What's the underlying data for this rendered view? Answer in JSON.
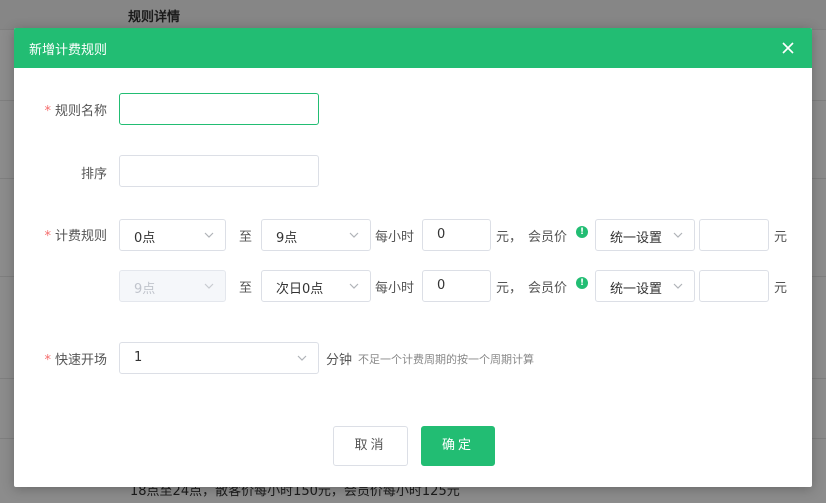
{
  "background": {
    "header_title": "规则详情",
    "footer_text": "18点至24点，散客价每小时150元，会员价每小时125元"
  },
  "modal": {
    "title": "新增计费规则",
    "fields": {
      "rule_name": {
        "label": "规则名称",
        "required": "*",
        "value": ""
      },
      "sort": {
        "label": "排序",
        "value": ""
      },
      "billing": {
        "label": "计费规则",
        "required": "*"
      },
      "quick_start": {
        "label": "快速开场",
        "required": "*",
        "value": "1",
        "unit": "分钟",
        "hint": "不足一个计费周期的按一个周期计算"
      }
    },
    "billing_rows": [
      {
        "start": "0点",
        "to": "至",
        "end": "9点",
        "per_hour": "每小时",
        "price": "0",
        "yuan_comma": "元，",
        "member_price": "会员价",
        "member_mode": "统一设置",
        "member_value": "",
        "yuan": "元"
      },
      {
        "start": "9点",
        "to": "至",
        "end": "次日0点",
        "per_hour": "每小时",
        "price": "0",
        "yuan_comma": "元，",
        "member_price": "会员价",
        "member_mode": "统一设置",
        "member_value": "",
        "yuan": "元"
      }
    ],
    "buttons": {
      "cancel": "取消",
      "ok": "确定"
    }
  },
  "colors": {
    "accent": "#22bd73",
    "required": "#f56c6c"
  }
}
